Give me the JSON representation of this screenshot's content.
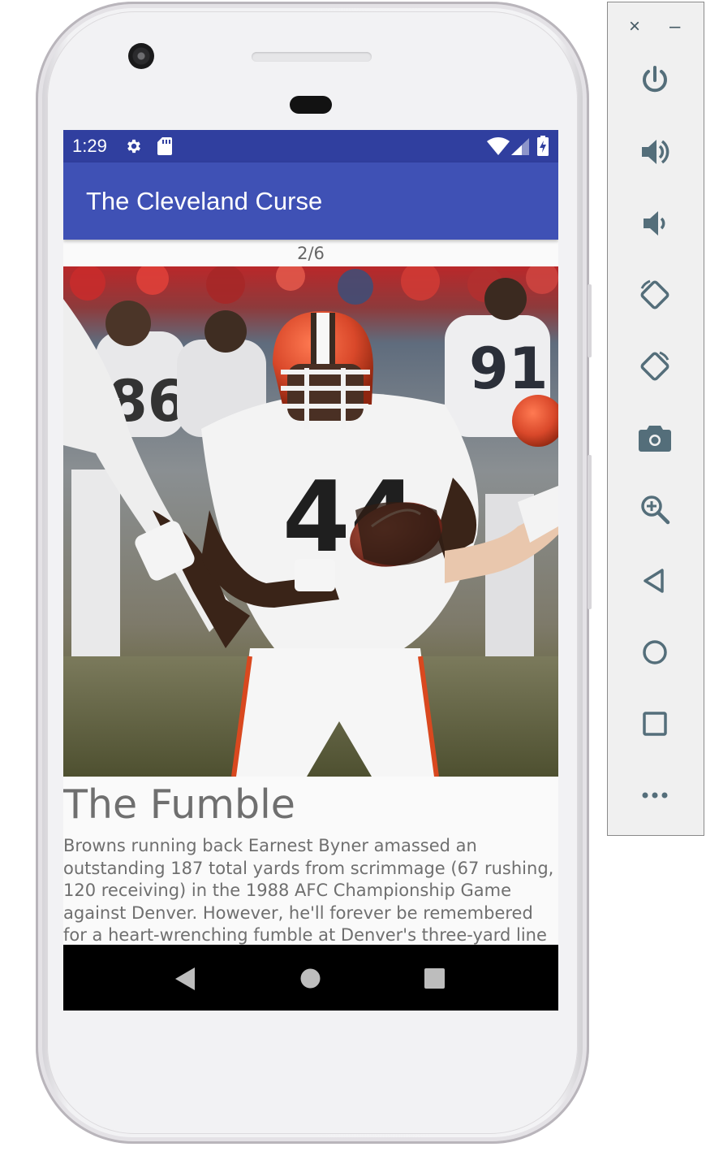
{
  "status_bar": {
    "time": "1:29",
    "background": "#303f9f",
    "icons": [
      "settings-icon",
      "sd-card-icon",
      "wifi-icon",
      "signal-icon",
      "battery-charging-icon"
    ]
  },
  "app_bar": {
    "title": "The Cleveland Curse",
    "background": "#3f51b5"
  },
  "gallery": {
    "counter": "2/6"
  },
  "article": {
    "title": "The Fumble",
    "body": "Browns running back Earnest Byner amassed an outstanding 187 total yards from scrimmage (67 rushing, 120 receiving) in the 1988 AFC Championship Game against Denver. However, he'll forever be remembered for a heart-wrenching fumble at Denver's three-yard line"
  },
  "nav_bar": {
    "buttons": [
      "back-icon",
      "home-icon",
      "recents-icon"
    ]
  },
  "emulator_panel": {
    "close_glyph": "×",
    "minimize_glyph": "–",
    "tools": [
      "power-icon",
      "volume-up-icon",
      "volume-down-icon",
      "rotate-left-icon",
      "rotate-right-icon",
      "camera-icon",
      "zoom-icon",
      "back-icon",
      "home-icon",
      "overview-icon",
      "more-icon"
    ],
    "icon_color": "#546e7a"
  }
}
